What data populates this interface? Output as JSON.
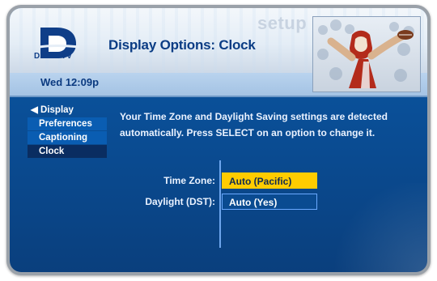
{
  "brand": {
    "logo_text": "DIRECTV",
    "logo_color": "#0f3e88"
  },
  "header": {
    "title": "Display Options: Clock",
    "section_word": "setup",
    "datetime": "Wed 12:09p"
  },
  "sidebar": {
    "items": [
      {
        "label": "◀ Display",
        "state": "parent"
      },
      {
        "label": "Preferences",
        "state": "normal"
      },
      {
        "label": "Captioning",
        "state": "normal"
      },
      {
        "label": "Clock",
        "state": "selected"
      }
    ]
  },
  "main": {
    "message": "Your Time Zone and Daylight Saving settings are detected automatically. Press SELECT on an option to change it.",
    "options": [
      {
        "label": "Time Zone:",
        "value": "Auto (Pacific)",
        "active": true
      },
      {
        "label": "Daylight (DST):",
        "value": "Auto (Yes)",
        "active": false
      }
    ]
  },
  "colors": {
    "accent": "#ffcc00",
    "panel_blue": "#0a4b91",
    "sidebar_selected": "#0a2d61"
  }
}
